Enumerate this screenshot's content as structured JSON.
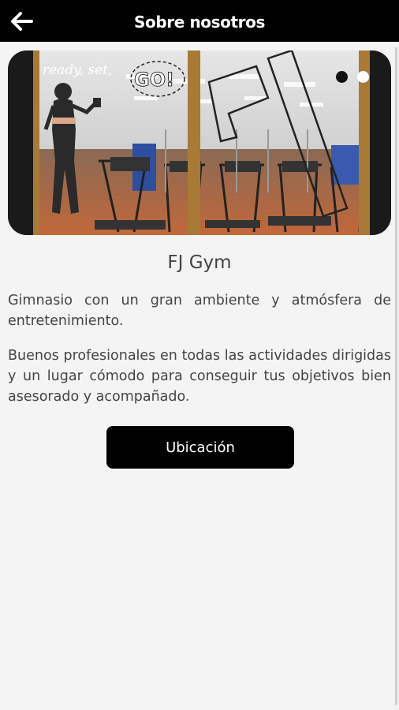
{
  "appbar": {
    "title": "Sobre nosotros",
    "back_icon": "arrow-left-icon"
  },
  "carousel": {
    "image_text": {
      "line1": "ready, set,",
      "line2": "GO!",
      "logo": "FJ"
    },
    "slide_count": 2,
    "active_index": 0
  },
  "gym": {
    "name": "FJ Gym",
    "description_1": "Gimnasio con un gran ambiente y atmósfera de entretenimiento.",
    "description_2": "Buenos profesionales en todas las actividades dirigidas y un lugar cómodo para conseguir tus objetivos bien asesorado y acompañado."
  },
  "actions": {
    "location_label": "Ubicación"
  },
  "colors": {
    "appbar_bg": "#000000",
    "page_bg": "#f4f4f4",
    "text": "#444444",
    "button_bg": "#000000"
  }
}
